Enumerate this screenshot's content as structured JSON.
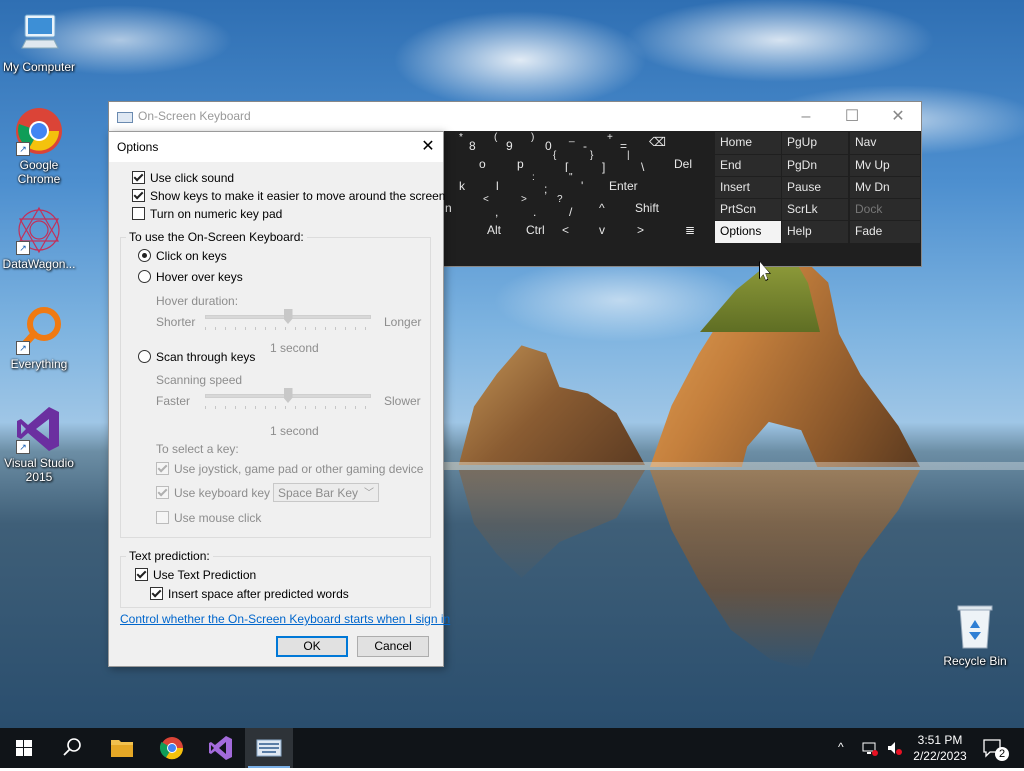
{
  "desktop": {
    "icons": [
      {
        "label": "My Computer",
        "name": "my-computer"
      },
      {
        "label": "Google Chrome",
        "name": "google-chrome"
      },
      {
        "label": "DataWagon...",
        "name": "datawagon"
      },
      {
        "label": "Everything",
        "name": "everything"
      },
      {
        "label": "Visual Studio 2015",
        "name": "visual-studio-2015"
      },
      {
        "label": "Recycle Bin",
        "name": "recycle-bin"
      }
    ]
  },
  "osk": {
    "title": "On-Screen Keyboard",
    "keys": {
      "row1": {
        "star": "*",
        "eight": "8",
        "lparen": "(",
        "nine": "9",
        "rparen": ")",
        "zero": "0",
        "minus_underscore": "_",
        "minus": "-",
        "plus": "+",
        "equals": "=",
        "backspace": "⌫"
      },
      "row2": {
        "o": "o",
        "p": "p",
        "lbrace": "{",
        "lbracket": "[",
        "rbrace": "}",
        "rbracket": "]",
        "pipe": "|",
        "backslash": "\\",
        "del": "Del"
      },
      "row3": {
        "k": "k",
        "l": "l",
        "colon": ":",
        "semicolon": ";",
        "quote": "\"",
        "apostrophe": "'",
        "enter": "Enter"
      },
      "row4": {
        "n": "n",
        "lt": "<",
        "comma": ",",
        "gt": ">",
        "period": ".",
        "question": "?",
        "slash": "/",
        "up": "^",
        "shift": "Shift"
      },
      "row5": {
        "alt": "Alt",
        "ctrl": "Ctrl",
        "left": "<",
        "down": "v",
        "right": ">",
        "menu": "≣"
      }
    },
    "nav_keys": {
      "home": "Home",
      "pgup": "PgUp",
      "nav": "Nav",
      "end": "End",
      "pgdn": "PgDn",
      "mvup": "Mv Up",
      "insert": "Insert",
      "pause": "Pause",
      "mvdn": "Mv Dn",
      "prtscn": "PrtScn",
      "scrlk": "ScrLk",
      "dock": "Dock",
      "options": "Options",
      "help": "Help",
      "fade": "Fade"
    }
  },
  "options_dialog": {
    "title": "Options",
    "use_click_sound": {
      "label": "Use click sound",
      "checked": true
    },
    "show_keys": {
      "label": "Show keys to make it easier to move around the screen",
      "checked": true
    },
    "numeric_keypad": {
      "label": "Turn on numeric key pad",
      "checked": false
    },
    "group_use": {
      "legend": "To use the On-Screen Keyboard:",
      "click_on_keys": {
        "label": "Click on keys",
        "selected": true
      },
      "hover_over_keys": {
        "label": "Hover over keys",
        "selected": false
      },
      "hover_duration": {
        "label": "Hover duration:",
        "min_label": "Shorter",
        "max_label": "Longer",
        "value_label": "1 second",
        "level": 0.5
      },
      "scan_through_keys": {
        "label": "Scan through keys",
        "selected": false
      },
      "scanning_speed": {
        "label": "Scanning speed",
        "min_label": "Faster",
        "max_label": "Slower",
        "value_label": "1 second",
        "level": 0.5
      },
      "to_select_key": "To select a key:",
      "use_joystick": {
        "label": "Use joystick, game pad or other gaming device",
        "checked": true
      },
      "use_keyboard_key": {
        "label": "Use keyboard key",
        "checked": true
      },
      "keyboard_key_select": "Space Bar Key",
      "use_mouse_click": {
        "label": "Use mouse click",
        "checked": false
      }
    },
    "group_prediction": {
      "legend": "Text prediction:",
      "use_text_prediction": {
        "label": "Use Text Prediction",
        "checked": true
      },
      "insert_space": {
        "label": "Insert space after predicted words",
        "checked": true
      }
    },
    "startup_link": "Control whether the On-Screen Keyboard starts when I sign in",
    "ok_label": "OK",
    "cancel_label": "Cancel"
  },
  "taskbar": {
    "time": "3:51 PM",
    "date": "2/22/2023",
    "notification_count": "2"
  }
}
